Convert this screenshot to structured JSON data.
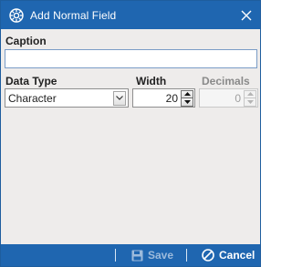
{
  "window": {
    "title": "Add Normal Field",
    "icon": "app-gear-icon",
    "close_icon": "close-icon"
  },
  "form": {
    "caption": {
      "label": "Caption",
      "value": ""
    },
    "data_type": {
      "label": "Data Type",
      "selected": "Character"
    },
    "width": {
      "label": "Width",
      "value": "20"
    },
    "decimals": {
      "label": "Decimals",
      "value": "0",
      "enabled": false
    }
  },
  "footer": {
    "save_label": "Save",
    "save_enabled": false,
    "cancel_label": "Cancel"
  },
  "colors": {
    "titlebar": "#1f66b0",
    "footer": "#1f66b0",
    "body": "#eeeceb"
  }
}
